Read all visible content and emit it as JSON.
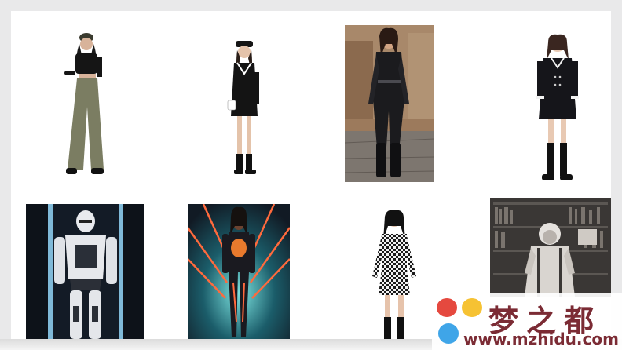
{
  "gallery": {
    "images": [
      {
        "subject": "woman in black crop top and olive wide-leg pants"
      },
      {
        "subject": "girl in black sailor dress with white bag"
      },
      {
        "subject": "woman in black leather jumpsuit and boots on cobblestone street"
      },
      {
        "subject": "girl in black tweed dress and knee socks"
      },
      {
        "subject": "white robot armor suit in dark corridor"
      },
      {
        "subject": "futuristic woman with neon light beams"
      },
      {
        "subject": "girl in checkered top and skirt"
      },
      {
        "subject": "elderly man with white hair in library, black and white"
      }
    ]
  },
  "watermark": {
    "title": "梦之都",
    "url": "www.mzhidu.com",
    "colors": {
      "text": "#7b2b34",
      "red": "#e5493f",
      "yellow": "#f6c233",
      "blue": "#3fa5e8"
    }
  }
}
